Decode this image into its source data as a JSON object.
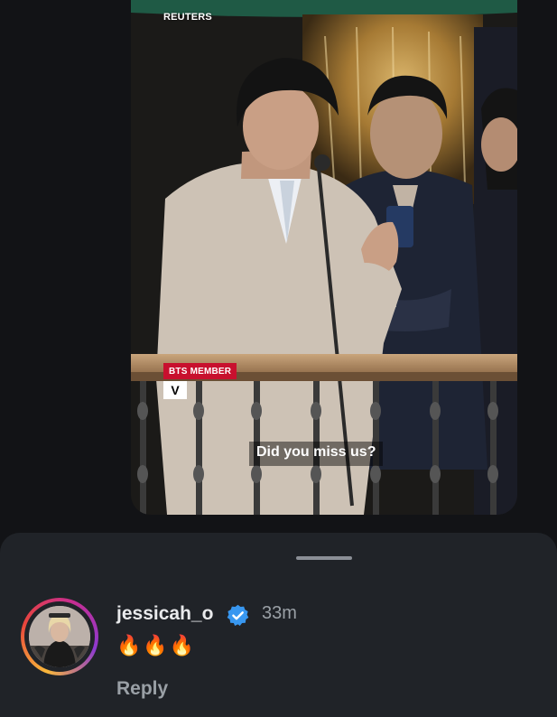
{
  "video": {
    "brand": "REUTERS",
    "lower_third_tag": "BTS MEMBER",
    "lower_third_name": "V",
    "subtitle": "Did you miss us?"
  },
  "comment": {
    "username": "jessicah_o",
    "verified": true,
    "time": "33m",
    "text": "🔥🔥🔥",
    "reply_label": "Reply"
  },
  "colors": {
    "background": "#121316",
    "sheet": "#202328",
    "accent_verified": "#3897f0",
    "news_red": "#c8102e"
  }
}
